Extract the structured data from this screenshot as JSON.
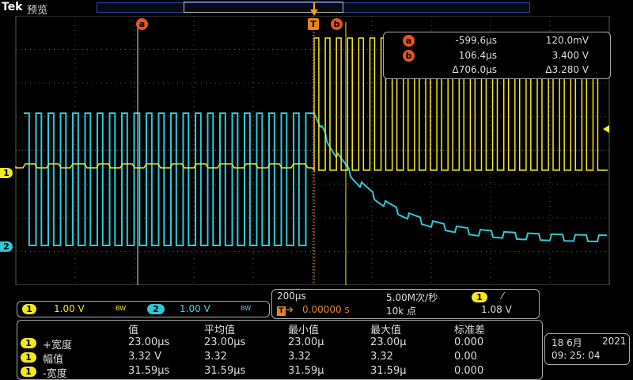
{
  "header": {
    "brand": "Tek",
    "mode": "预览"
  },
  "trigger_marker": "T",
  "cursors": {
    "a": {
      "label": "a",
      "time": "-599.6µs",
      "level": "120.0mV"
    },
    "b": {
      "label": "b",
      "time": "106.4µs",
      "level": "3.400 V"
    },
    "delta": {
      "time": "Δ706.0µs",
      "level": "Δ3.280 V"
    }
  },
  "channels": [
    {
      "num": "1",
      "scale": "1.00 V",
      "bw": "BW",
      "color": "#f4e81c"
    },
    {
      "num": "2",
      "scale": "1.00 V",
      "bw": "BW",
      "color": "#2ec8d8"
    }
  ],
  "timebase": {
    "scale": "200µs",
    "sample_rate": "5.00M次/秒",
    "trigger_pos": "0.00000 s",
    "record_length": "10k 点",
    "trigger_channel": "1",
    "trigger_slope": "⁄",
    "trigger_level": "1.08 V"
  },
  "measurements": {
    "headers": [
      "值",
      "平均值",
      "最小值",
      "最大值",
      "标准差"
    ],
    "rows": [
      {
        "ch": "1",
        "name": "+宽度",
        "values": [
          "23.00µs",
          "23.00µs",
          "23.00µ",
          "23.00µ",
          "0.000"
        ]
      },
      {
        "ch": "1",
        "name": "幅值",
        "values": [
          "3.32 V",
          "3.32",
          "3.32",
          "3.32",
          "0.00"
        ]
      },
      {
        "ch": "1",
        "name": "-宽度",
        "values": [
          "31.59µs",
          "31.59µs",
          "31.59µ",
          "31.59µ",
          "0.000"
        ]
      }
    ]
  },
  "datetime": {
    "date": "18 6月",
    "year": "2021",
    "time": "09: 25: 04"
  },
  "colors": {
    "ch1": "#f4e81c",
    "ch2": "#2ec8d8",
    "cursor": "#e8541c",
    "grid": "#5a5a5a"
  }
}
